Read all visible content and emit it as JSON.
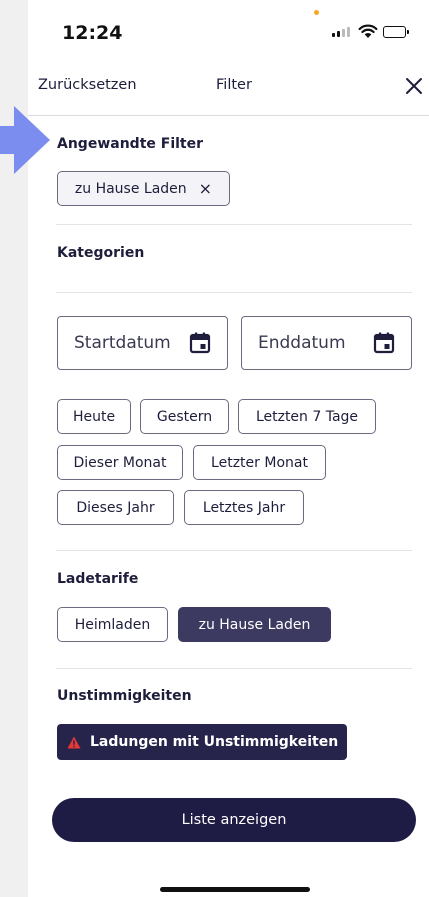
{
  "status_bar": {
    "time": "12:24"
  },
  "header": {
    "reset_label": "Zurücksetzen",
    "title": "Filter"
  },
  "applied_filters": {
    "title": "Angewandte Filter",
    "chips": [
      "zu Hause Laden"
    ],
    "remove_symbol": "×"
  },
  "categories": {
    "title": "Kategorien"
  },
  "date_range": {
    "start_label": "Startdatum",
    "end_label": "Enddatum"
  },
  "date_presets": [
    "Heute",
    "Gestern",
    "Letzten 7 Tage",
    "Dieser Monat",
    "Letzter Monat",
    "Dieses Jahr",
    "Letztes Jahr"
  ],
  "tariffs": {
    "title": "Ladetarife",
    "options": [
      {
        "label": "Heimladen",
        "selected": false
      },
      {
        "label": "zu Hause Laden",
        "selected": true
      }
    ]
  },
  "discrepancies": {
    "title": "Unstimmigkeiten",
    "chip_label": "Ladungen mit Unstimmigkeiten",
    "icon": "warning-icon"
  },
  "footer": {
    "button_label": "Liste anzeigen"
  },
  "colors": {
    "primary": "#1e1c45",
    "selected_chip": "#3d3a62",
    "pointer_arrow": "#7b8ef0",
    "warning": "#e53935",
    "status_dot": "#f5a623"
  }
}
